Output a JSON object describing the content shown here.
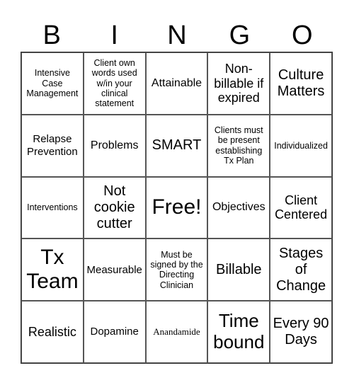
{
  "header": [
    "B",
    "I",
    "N",
    "G",
    "O"
  ],
  "cells": [
    "Intensive Case Management",
    "Client own words used w/in your clinical statement",
    "Attainable",
    "Non-billable if expired",
    "Culture Matters",
    "Relapse Prevention",
    "Problems",
    "SMART",
    "Clients must be present establishing Tx Plan",
    "Individualized",
    "Interventions",
    "Not cookie cutter",
    "Free!",
    "Objectives",
    "Client Centered",
    "Tx Team",
    "Measurable",
    "Must be signed by the Directing Clinician",
    "Billable",
    "Stages of Change",
    "Realistic",
    "Dopamine",
    "Anandamide",
    "Time bound",
    "Every 90 Days"
  ]
}
